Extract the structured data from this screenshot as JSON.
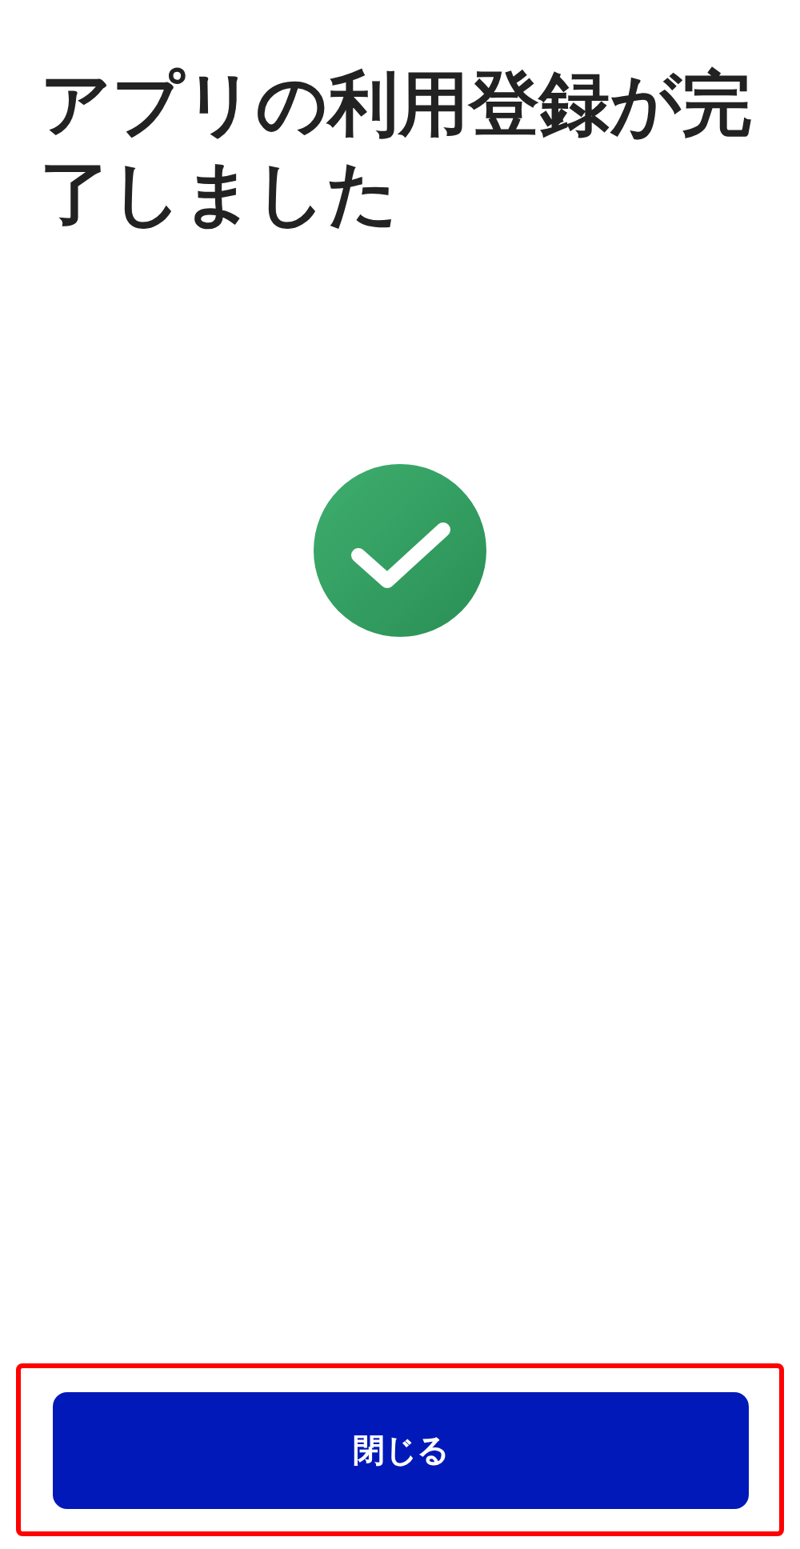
{
  "title": "アプリの利用登録が完了しました",
  "buttons": [
    {
      "label": "閉じる",
      "kind": "primary"
    }
  ]
}
